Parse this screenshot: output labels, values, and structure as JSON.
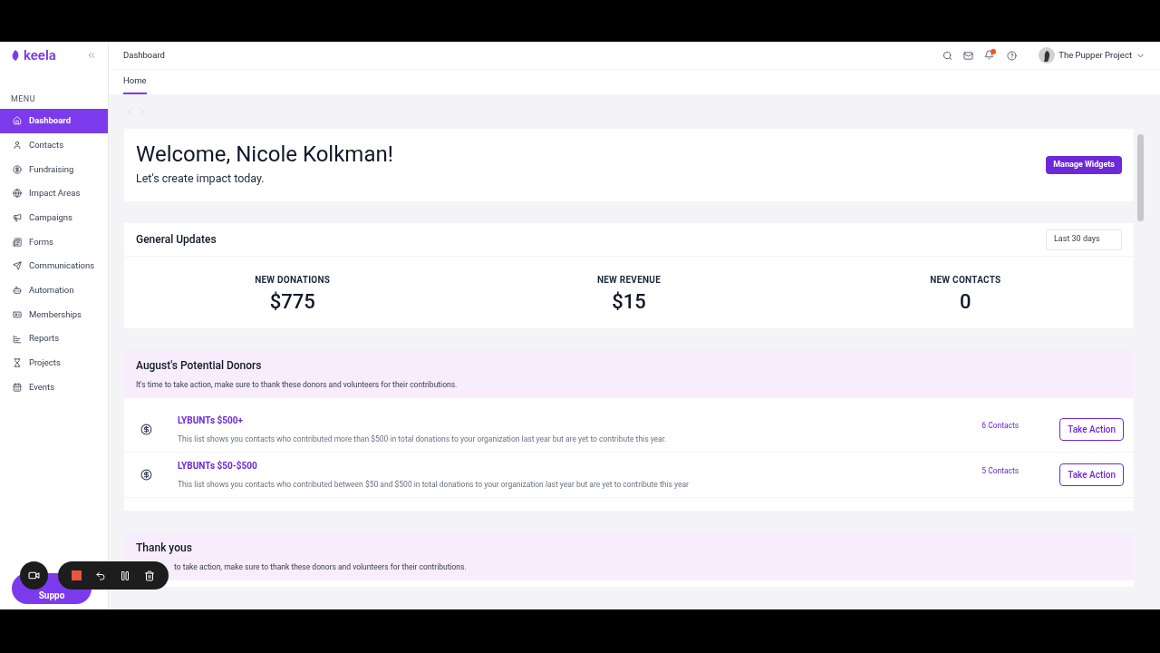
{
  "brand": "keela",
  "menu_label": "MENU",
  "nav": [
    {
      "label": "Dashboard",
      "selected": true
    },
    {
      "label": "Contacts",
      "selected": false
    },
    {
      "label": "Fundraising",
      "selected": false
    },
    {
      "label": "Impact Areas",
      "selected": false
    },
    {
      "label": "Campaigns",
      "selected": false
    },
    {
      "label": "Forms",
      "selected": false
    },
    {
      "label": "Communications",
      "selected": false
    },
    {
      "label": "Automation",
      "selected": false
    },
    {
      "label": "Memberships",
      "selected": false
    },
    {
      "label": "Reports",
      "selected": false
    },
    {
      "label": "Projects",
      "selected": false
    },
    {
      "label": "Events",
      "selected": false
    }
  ],
  "breadcrumb": "Dashboard",
  "tabs": [
    {
      "label": "Home",
      "selected": true
    }
  ],
  "header": {
    "notification_unread": true,
    "org_name": "The Pupper Project"
  },
  "welcome": {
    "title": "Welcome, Nicole Kolkman!",
    "subtitle": "Let's create impact today.",
    "button": "Manage Widgets"
  },
  "general_updates": {
    "title": "General Updates",
    "range": "Last 30 days",
    "stats": [
      {
        "label": "NEW DONATIONS",
        "value": "$775"
      },
      {
        "label": "NEW REVENUE",
        "value": "$15"
      },
      {
        "label": "NEW CONTACTS",
        "value": "0"
      }
    ]
  },
  "potential_donors": {
    "title": "August's Potential Donors",
    "description": "It's time to take action, make sure to thank these donors and volunteers for their contributions.",
    "lists": [
      {
        "title": "LYBUNTs $500+",
        "description": "This list shows you contacts who contributed more than $500 in total donations to your organization last year but are yet to contribute this year.",
        "count": "6 Contacts",
        "action": "Take Action"
      },
      {
        "title": "LYBUNTs $50-$500",
        "description": "This list shows you contacts who contributed between $50 and $500 in total donations to your organization last year but are yet to contribute this year",
        "count": "5 Contacts",
        "action": "Take Action"
      }
    ]
  },
  "thank_yous": {
    "title": "Thank yous",
    "description": "to take action, make sure to thank these donors and volunteers for their contributions."
  },
  "support_button": "Suppo"
}
